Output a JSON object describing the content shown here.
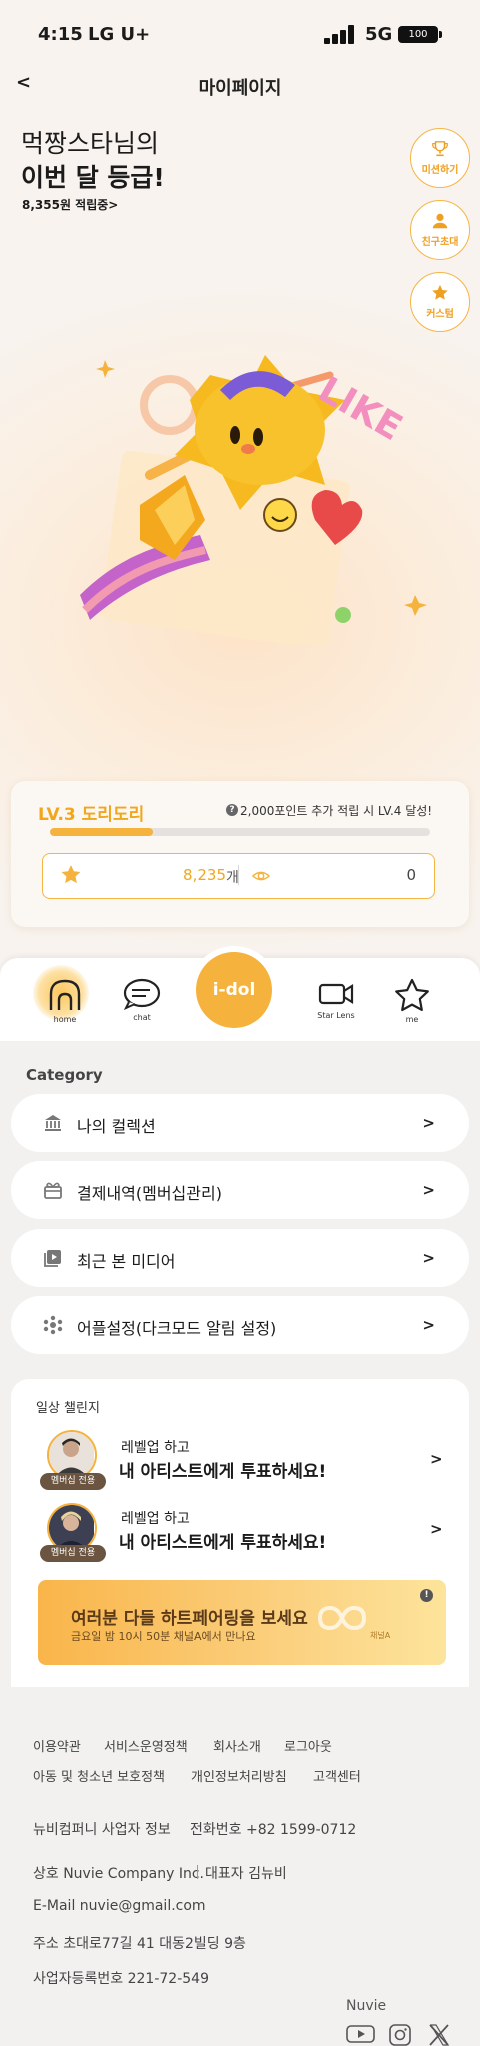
{
  "status_bar": {
    "time": "4:15",
    "carrier": "LG U+",
    "network": "5G",
    "battery": "100"
  },
  "header": {
    "back": "<",
    "title": "마이페이지"
  },
  "greeting": {
    "line1": "먹짱스타님의",
    "line2": "이번 달 등급!",
    "points_link": "8,355원 적립중>"
  },
  "side_buttons": [
    {
      "label": "미션하기",
      "icon": "trophy-icon"
    },
    {
      "label": "친구초대",
      "icon": "person-icon"
    },
    {
      "label": "커스텀",
      "icon": "star-icon"
    }
  ],
  "mascot_text": "LIKE",
  "level": {
    "name": "LV.3 도리도리",
    "hint": "2,000포인트 추가 적립 시 LV.4 달성!",
    "hint_icon": "?",
    "progress": 0.27,
    "star_count": "8,235",
    "star_unit": "개",
    "views": "0"
  },
  "nav": {
    "home": "home",
    "chat": "chat",
    "center": "i-dol",
    "star_lens": "Star Lens",
    "me": "me"
  },
  "category": {
    "title": "Category",
    "items": [
      {
        "label": "나의 컬렉션",
        "icon": "bank-icon",
        "arrow": ">"
      },
      {
        "label": "결제내역(멤버십관리)",
        "icon": "gift-icon",
        "arrow": ">"
      },
      {
        "label": "최근 본 미디어",
        "icon": "media-play-icon",
        "arrow": ">"
      },
      {
        "label": "어플설정(다크모드 알림 설정)",
        "icon": "settings-icon",
        "arrow": ">"
      }
    ]
  },
  "challenge": {
    "title": "일상 챌린지",
    "rows": [
      {
        "badge": "멤버십 전용",
        "sub": "레벨업 하고",
        "main": "내 아티스트에게 투표하세요!",
        "arrow": ">"
      },
      {
        "badge": "멤버십 전용",
        "sub": "레벨업 하고",
        "main": "내 아티스트에게 투표하세요!",
        "arrow": ">"
      }
    ]
  },
  "banner": {
    "title": "여러분 다들 하트페어링을 보세요",
    "subtitle": "금요일 밤 10시 50분 채널A에서 만나요",
    "info": "!",
    "channel": "채널A"
  },
  "footer": {
    "links_row1": [
      "이용약관",
      "서비스운영정책",
      "회사소개",
      "로그아웃"
    ],
    "links_row2": [
      "아동 및 청소년 보호정책",
      "개인정보처리방침",
      "고객센터"
    ],
    "company_info": "뉴비컴퍼니 사업자 정보",
    "phone": "전화번호 +82 1599-0712",
    "company_name": "상호 Nuvie Company Inc.",
    "ceo": "대표자 김뉴비",
    "email": "E-Mail nuvie@gmail.com",
    "address": "주소 초대로77길 41 대동2빌딩 9층",
    "biz_number": "사업자등록번호 221-72-549",
    "brand": "Nuvie"
  },
  "colors": {
    "accent": "#f5b23c",
    "accent_text": "#f2a61c",
    "badge": "#6b5440"
  }
}
